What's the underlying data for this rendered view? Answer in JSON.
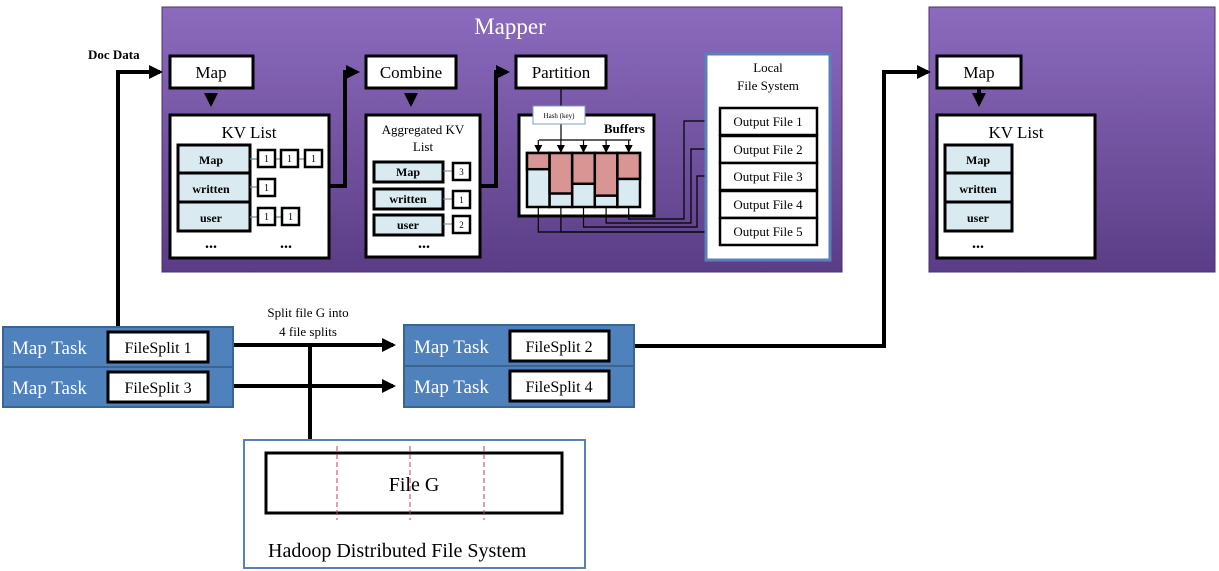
{
  "mapper": {
    "title": "Mapper",
    "doc_data_label": "Doc Data",
    "map_label": "Map",
    "combine_label": "Combine",
    "partition_label": "Partition",
    "kv_list": {
      "title": "KV List",
      "keys": [
        "Map",
        "written",
        "user"
      ],
      "values": [
        [
          "1",
          "1",
          "1"
        ],
        [
          "1"
        ],
        [
          "1",
          "1"
        ]
      ],
      "ellipsis": "..."
    },
    "aggregated": {
      "title_line1": "Aggregated KV",
      "title_line2": "List",
      "keys": [
        "Map",
        "written",
        "user"
      ],
      "values": [
        "3",
        "1",
        "2"
      ],
      "ellipsis": "..."
    },
    "hash_label": "Hash (key)",
    "buffers_label": "Buffers",
    "buffer_fill_fraction": [
      0.3,
      0.75,
      0.57,
      0.79,
      0.48
    ],
    "local_fs": {
      "title_line1": "Local",
      "title_line2": "File System",
      "files": [
        "Output File 1",
        "Output File 2",
        "Output File 3",
        "Output File 4",
        "Output File 5"
      ]
    }
  },
  "reducer_panel": {
    "map_label": "Map",
    "kv_list": {
      "title": "KV List",
      "keys": [
        "Map",
        "written",
        "user"
      ],
      "ellipsis": "..."
    }
  },
  "tasks": {
    "split_note_line1": "Split file G into",
    "split_note_line2": "4 file splits",
    "left": [
      {
        "label": "Map Task",
        "split": "FileSplit 1"
      },
      {
        "label": "Map Task",
        "split": "FileSplit 3"
      }
    ],
    "right": [
      {
        "label": "Map Task",
        "split": "FileSplit 2"
      },
      {
        "label": "Map Task",
        "split": "FileSplit 4"
      }
    ]
  },
  "hdfs": {
    "file_label": "File G",
    "title": "Hadoop Distributed File System"
  },
  "colors": {
    "panel_top": "#8c6bbd",
    "panel_bottom": "#5a3d86",
    "task_blue": "#4f81bd",
    "cell_blue": "#d9eaf1",
    "buffer_red": "#d99594",
    "fs_border": "#5b7fb8"
  }
}
